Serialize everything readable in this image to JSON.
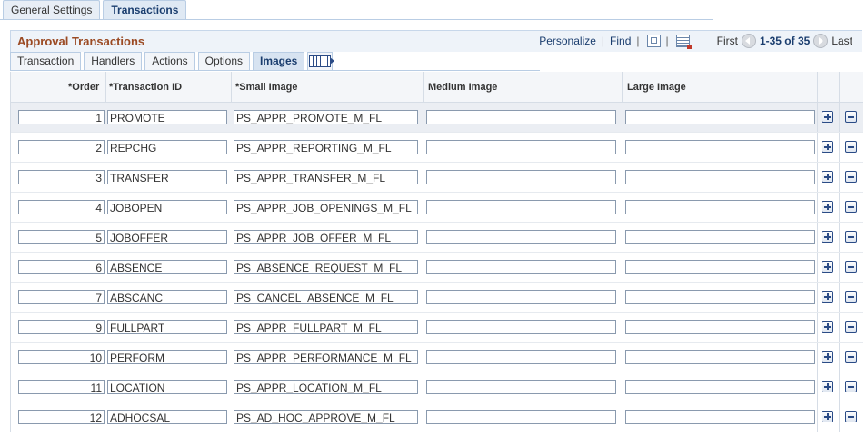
{
  "page_tabs": [
    {
      "label": "General Settings",
      "active": false
    },
    {
      "label": "Transactions",
      "active": true
    }
  ],
  "grid": {
    "title": "Approval Transactions",
    "personalize": "Personalize",
    "find": "Find",
    "first": "First",
    "range": "1-35 of 35",
    "last": "Last"
  },
  "grid_tabs": [
    {
      "label": "Transaction",
      "active": false
    },
    {
      "label": "Handlers",
      "active": false
    },
    {
      "label": "Actions",
      "active": false
    },
    {
      "label": "Options",
      "active": false
    },
    {
      "label": "Images",
      "active": true
    }
  ],
  "columns": {
    "order": "*Order",
    "transaction_id": "*Transaction ID",
    "small_image": "*Small Image",
    "medium_image": "Medium Image",
    "large_image": "Large Image"
  },
  "rows": [
    {
      "order": "1",
      "id": "PROMOTE",
      "small": "PS_APPR_PROMOTE_M_FL",
      "medium": "",
      "large": ""
    },
    {
      "order": "2",
      "id": "REPCHG",
      "small": "PS_APPR_REPORTING_M_FL",
      "medium": "",
      "large": ""
    },
    {
      "order": "3",
      "id": "TRANSFER",
      "small": "PS_APPR_TRANSFER_M_FL",
      "medium": "",
      "large": ""
    },
    {
      "order": "4",
      "id": "JOBOPEN",
      "small": "PS_APPR_JOB_OPENINGS_M_FL",
      "medium": "",
      "large": ""
    },
    {
      "order": "5",
      "id": "JOBOFFER",
      "small": "PS_APPR_JOB_OFFER_M_FL",
      "medium": "",
      "large": ""
    },
    {
      "order": "6",
      "id": "ABSENCE",
      "small": "PS_ABSENCE_REQUEST_M_FL",
      "medium": "",
      "large": ""
    },
    {
      "order": "7",
      "id": "ABSCANC",
      "small": "PS_CANCEL_ABSENCE_M_FL",
      "medium": "",
      "large": ""
    },
    {
      "order": "9",
      "id": "FULLPART",
      "small": "PS_APPR_FULLPART_M_FL",
      "medium": "",
      "large": ""
    },
    {
      "order": "10",
      "id": "PERFORM",
      "small": "PS_APPR_PERFORMANCE_M_FL",
      "medium": "",
      "large": ""
    },
    {
      "order": "11",
      "id": "LOCATION",
      "small": "PS_APPR_LOCATION_M_FL",
      "medium": "",
      "large": ""
    },
    {
      "order": "12",
      "id": "ADHOCSAL",
      "small": "PS_AD_HOC_APPROVE_M_FL",
      "medium": "",
      "large": ""
    }
  ]
}
